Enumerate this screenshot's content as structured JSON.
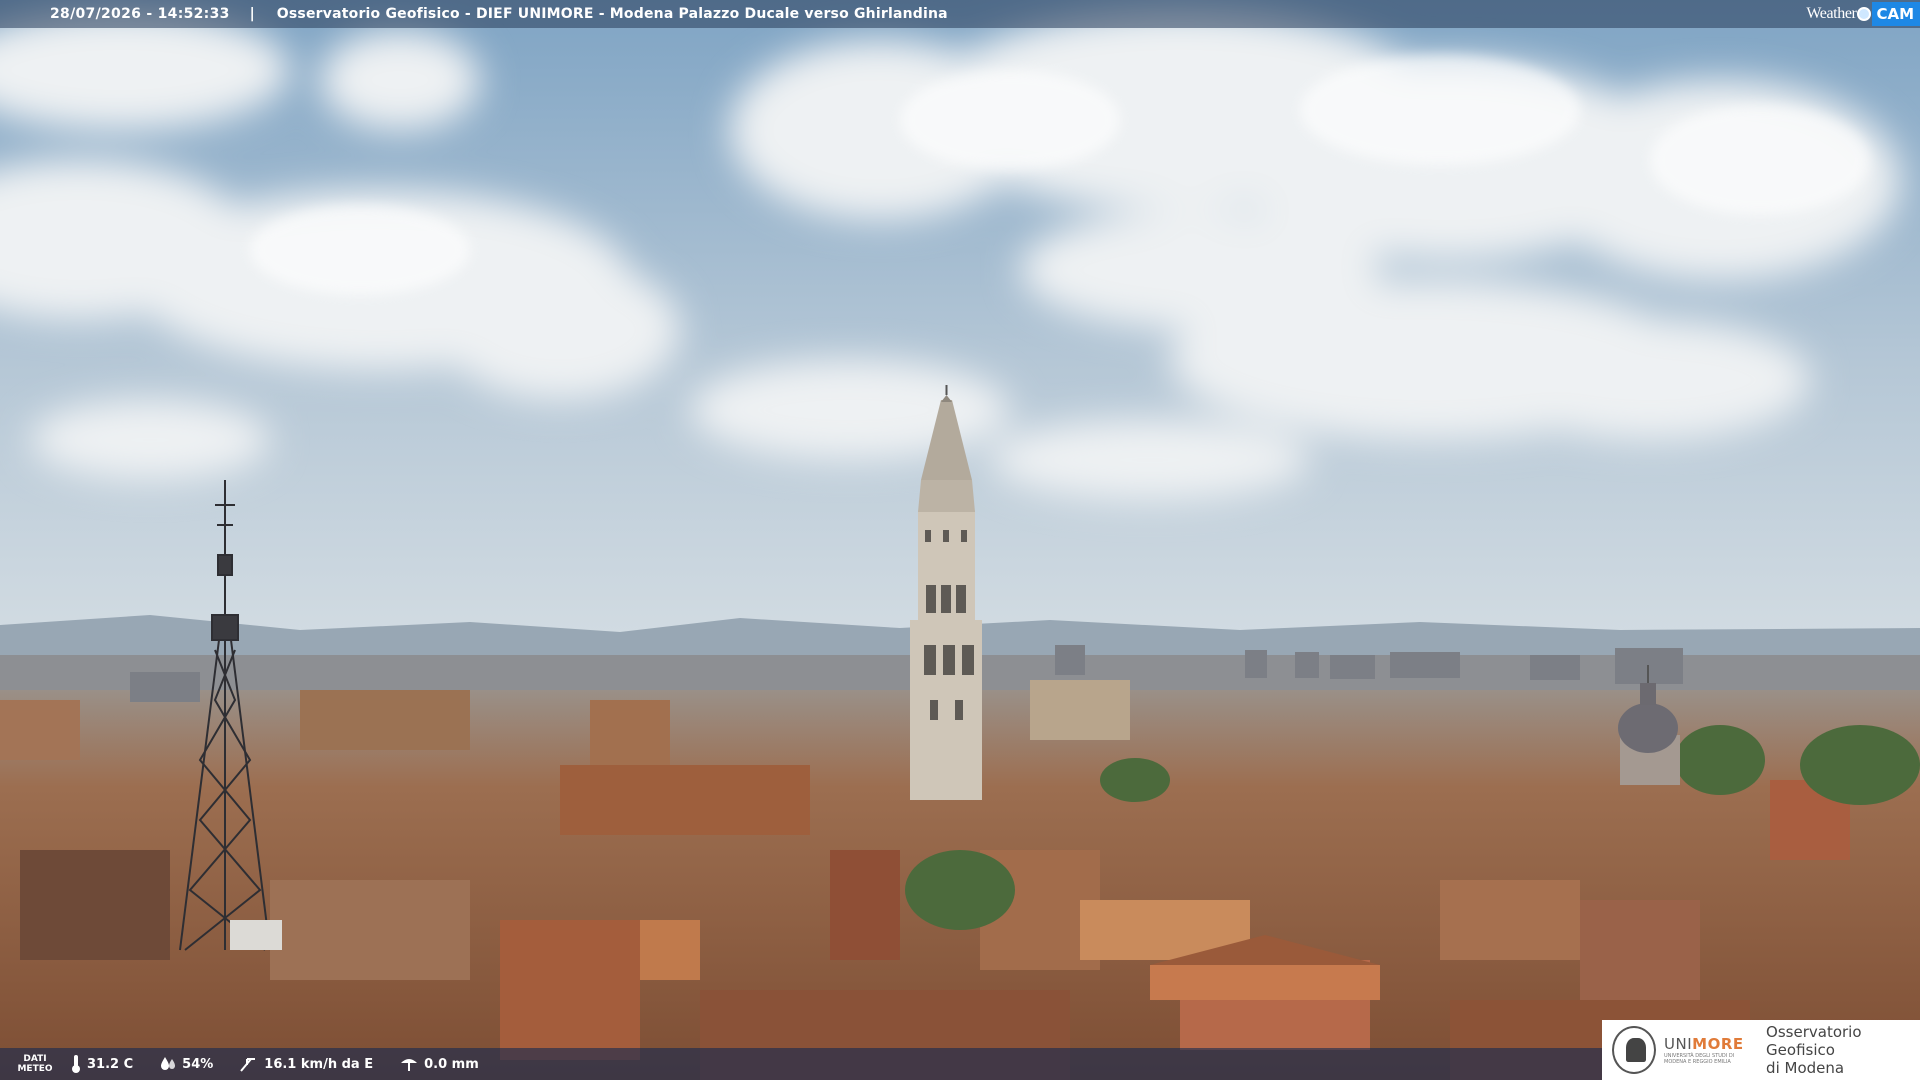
{
  "header": {
    "timestamp": "28/07/2026 - 14:52:33",
    "separator": "|",
    "camera_title": "Osservatorio Geofisico - DIEF UNIMORE - Modena Palazzo Ducale verso Ghirlandina",
    "brand_weather": "Weather",
    "brand_cam": "CAM"
  },
  "meteo": {
    "label_line1": "DATI",
    "label_line2": "METEO",
    "temperature": "31.2 C",
    "humidity": "54%",
    "wind": "16.1 km/h da E",
    "rain": "0.0 mm"
  },
  "logo": {
    "uni_prefix": "UNI",
    "uni_suffix": "MORE",
    "uni_subtitle": "UNIVERSITÀ DEGLI STUDI DI MODENA E REGGIO EMILIA",
    "observatory_line1": "Osservatorio Geofisico",
    "observatory_line2": "di Modena"
  },
  "icons": [
    "thermometer-icon",
    "humidity-icon",
    "wind-icon",
    "rain-icon",
    "university-seal-icon"
  ],
  "colors": {
    "sky_top": "#7fa4c4",
    "sky_horizon": "#d4dde3",
    "roof": "#a86a45",
    "tower": "#cfc6b8",
    "accent_orange": "#e07b39",
    "cam_blue": "#1e88e5"
  }
}
